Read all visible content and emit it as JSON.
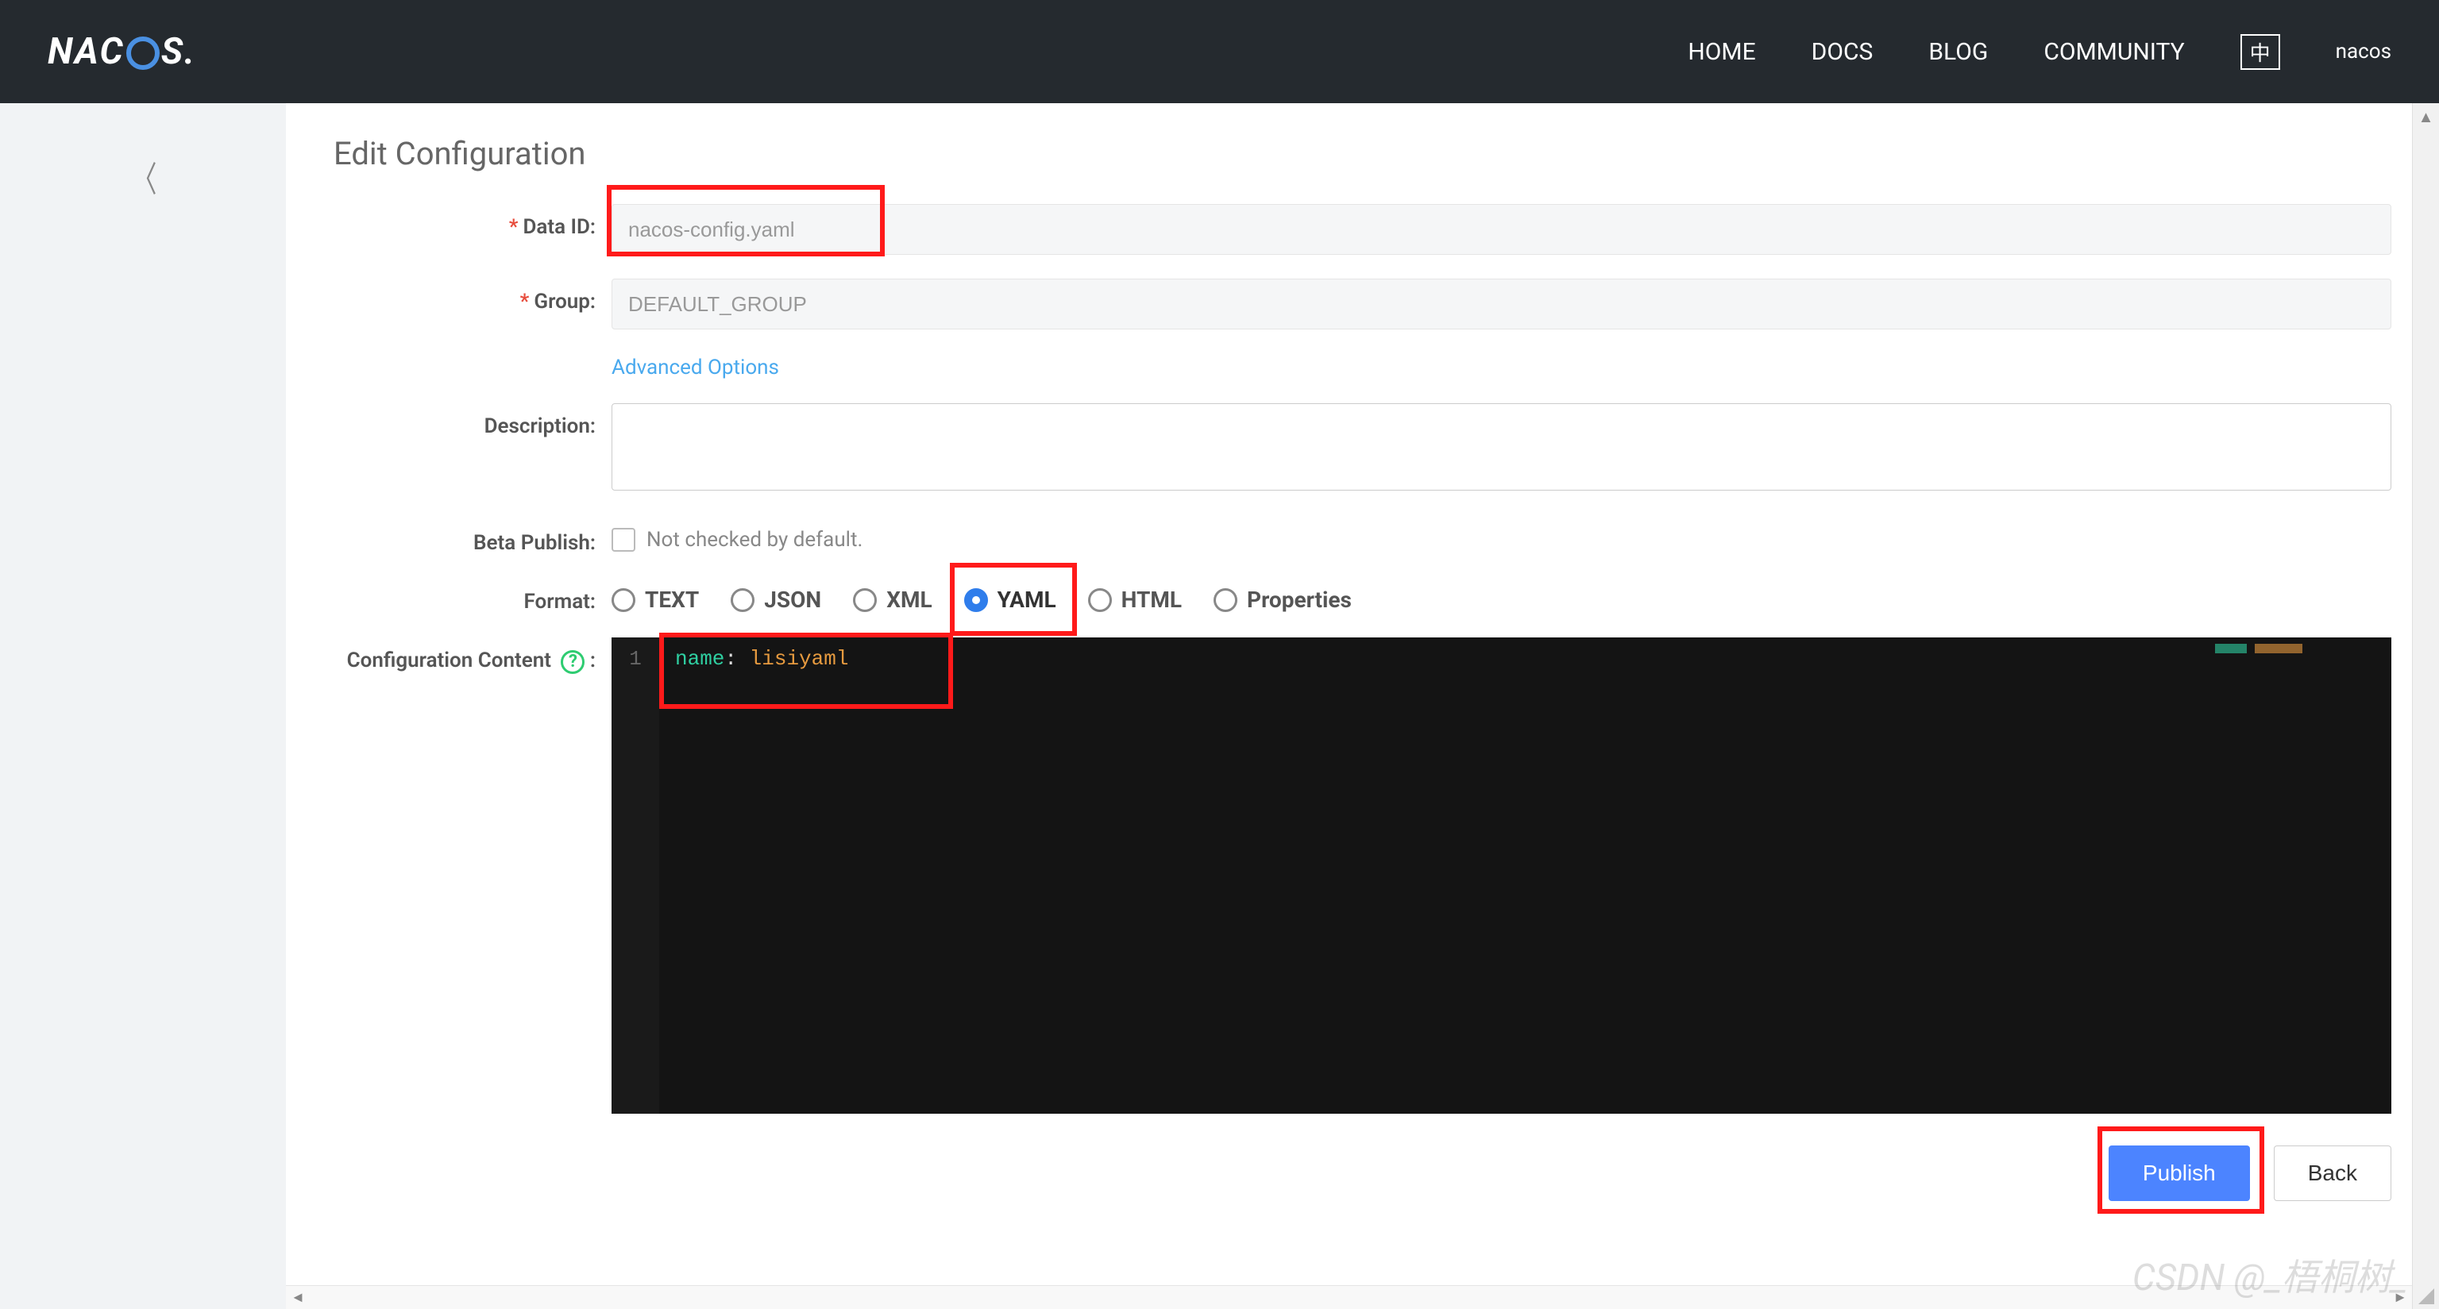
{
  "nav": {
    "logo_prefix": "NAC",
    "logo_suffix": "S.",
    "links": [
      "HOME",
      "DOCS",
      "BLOG",
      "COMMUNITY"
    ],
    "lang": "中",
    "user": "nacos"
  },
  "page": {
    "title": "Edit Configuration",
    "labels": {
      "data_id": "Data ID:",
      "group": "Group:",
      "advanced": "Advanced Options",
      "description": "Description:",
      "beta": "Beta Publish:",
      "beta_hint": "Not checked by default.",
      "format": "Format:",
      "config_content": "Configuration Content",
      "config_content_suffix": ":"
    },
    "fields": {
      "data_id": "nacos-config.yaml",
      "group": "DEFAULT_GROUP",
      "description": "",
      "beta_checked": false
    },
    "formats": [
      {
        "label": "TEXT",
        "selected": false
      },
      {
        "label": "JSON",
        "selected": false
      },
      {
        "label": "XML",
        "selected": false
      },
      {
        "label": "YAML",
        "selected": true
      },
      {
        "label": "HTML",
        "selected": false
      },
      {
        "label": "Properties",
        "selected": false
      }
    ],
    "editor": {
      "gutter": "1",
      "key": "name",
      "colon": ":",
      "value": "lisiyaml"
    },
    "buttons": {
      "publish": "Publish",
      "back": "Back"
    }
  },
  "watermark": "CSDN @_梧桐树_"
}
